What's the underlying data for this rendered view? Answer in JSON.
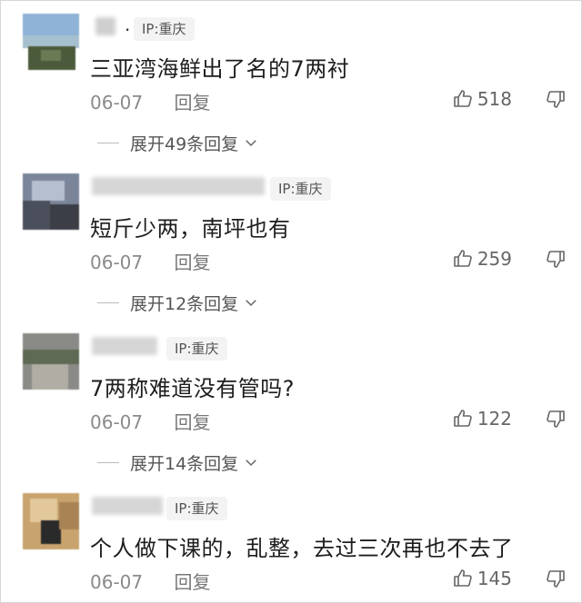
{
  "comments": [
    {
      "ip": "IP:重庆",
      "name_glyph": ".",
      "text": "三亚湾海鲜出了名的7两衬",
      "date": "06-07",
      "reply_label": "回复",
      "likes": "518",
      "expand_label": "展开49条回复"
    },
    {
      "ip": "IP:重庆",
      "text": "短斤少两，南坪也有",
      "date": "06-07",
      "reply_label": "回复",
      "likes": "259",
      "expand_label": "展开12条回复"
    },
    {
      "ip": "IP:重庆",
      "text": "7两称难道没有管吗?",
      "date": "06-07",
      "reply_label": "回复",
      "likes": "122",
      "expand_label": "展开14条回复"
    },
    {
      "ip": "IP:重庆",
      "text": "个人做下课的，乱整，去过三次再也不去了",
      "date": "06-07",
      "reply_label": "回复",
      "likes": "145"
    }
  ],
  "icons": {
    "like": "thumbs-up-icon",
    "dislike": "thumbs-down-icon",
    "expand": "chevron-down-icon"
  },
  "colors": {
    "text": "#1d1d1d",
    "meta": "#8a8a8a",
    "badge_bg": "#f3f3f3"
  }
}
